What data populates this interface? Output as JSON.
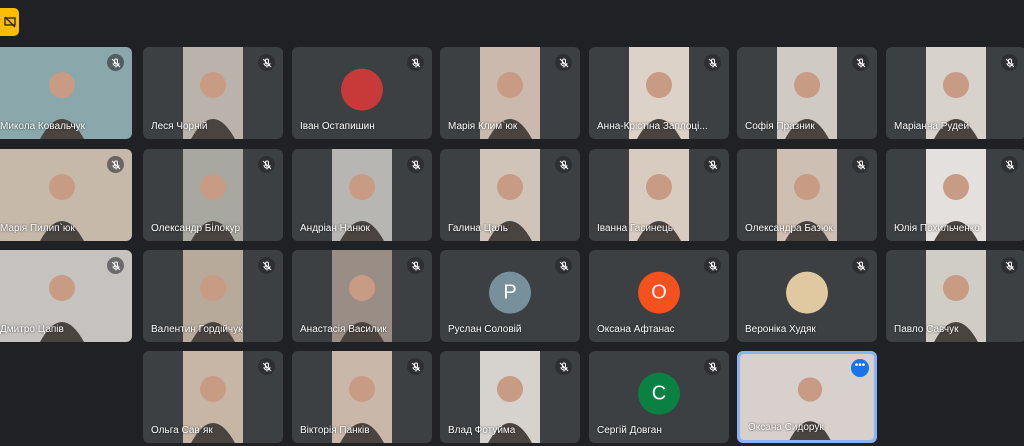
{
  "presentation_badge_icon": "presentation-off-icon",
  "participants": [
    {
      "name": "Микола Ковальчук",
      "muted": true,
      "type": "video",
      "color": "#8aa8ac"
    },
    {
      "name": "Леся Чорній",
      "muted": true,
      "type": "video",
      "color": "#b9b3ab"
    },
    {
      "name": "Іван Остапишин",
      "muted": true,
      "type": "avatar-image",
      "color": "#c83a3a"
    },
    {
      "name": "Марія Клим`юк",
      "muted": true,
      "type": "video",
      "color": "#cbb9ae"
    },
    {
      "name": "Анна-Крістіна Заплоці...",
      "muted": true,
      "type": "video",
      "color": "#ddd2c7"
    },
    {
      "name": "Софія Празник",
      "muted": true,
      "type": "video",
      "color": "#cfcac3"
    },
    {
      "name": "Маріанна Рудей",
      "muted": true,
      "type": "video",
      "color": "#d7d2cc"
    },
    {
      "name": "Марія Пилип`юк",
      "muted": true,
      "type": "video",
      "color": "#c6b9aa"
    },
    {
      "name": "Олександр Білокур",
      "muted": true,
      "type": "video",
      "color": "#a9a8a0"
    },
    {
      "name": "Андріан Нанюк",
      "muted": true,
      "type": "video",
      "color": "#b7b6b3"
    },
    {
      "name": "Галина Цаль",
      "muted": true,
      "type": "video",
      "color": "#cfc4b7"
    },
    {
      "name": "Іванна Гасинець",
      "muted": true,
      "type": "video",
      "color": "#d8cbbf"
    },
    {
      "name": "Олександра Базюк",
      "muted": true,
      "type": "video",
      "color": "#cdbfb1"
    },
    {
      "name": "Юлія Похильченко",
      "muted": true,
      "type": "video",
      "color": "#e4e0dd"
    },
    {
      "name": "Дмитро Цапів",
      "muted": true,
      "type": "video",
      "color": "#c6c2c0"
    },
    {
      "name": "Валентин Гордійчук",
      "muted": true,
      "type": "video",
      "color": "#b8aa9b"
    },
    {
      "name": "Анастасія Василик",
      "muted": true,
      "type": "video",
      "color": "#9a8d86"
    },
    {
      "name": "Руслан Соловій",
      "muted": true,
      "type": "letter",
      "letter": "P",
      "color": "#78909c"
    },
    {
      "name": "Оксана Афтанас",
      "muted": true,
      "type": "letter",
      "letter": "O",
      "color": "#f4511e"
    },
    {
      "name": "Вероніка Худяк",
      "muted": true,
      "type": "avatar-image",
      "color": "#e0c9a0"
    },
    {
      "name": "Павло Савчук",
      "muted": true,
      "type": "video",
      "color": "#d0ccc6"
    },
    {
      "name": "Ольга Сав`як",
      "muted": true,
      "type": "video",
      "color": "#c7b6a5"
    },
    {
      "name": "Вікторія Панків",
      "muted": true,
      "type": "video",
      "color": "#c9b8aa"
    },
    {
      "name": "Влад Фотуйма",
      "muted": true,
      "type": "video",
      "color": "#d6d3cf"
    },
    {
      "name": "Сергій Довган",
      "muted": true,
      "type": "letter",
      "letter": "C",
      "color": "#0b8043"
    },
    {
      "name": "Оксана Сидорук",
      "muted": false,
      "type": "video",
      "color": "#d7d0cc",
      "active": true
    }
  ]
}
